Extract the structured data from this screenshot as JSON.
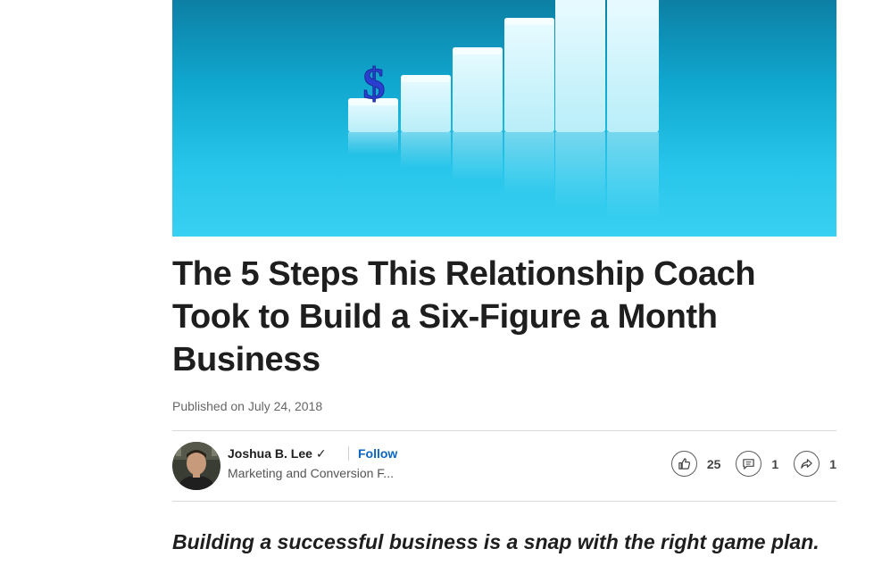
{
  "hero": {
    "icon": "dollar-bar-chart-icon",
    "dollar_symbol": "$"
  },
  "article": {
    "title": "The 5 Steps This Relationship Coach Took to Build a Six-Figure a Month Business",
    "published": "Published on July 24, 2018",
    "intro": "Building a successful business is a snap with the right game plan."
  },
  "author": {
    "name": "Joshua B. Lee",
    "verified_mark": "✓",
    "follow_label": "Follow",
    "headline": "Marketing and Conversion F..."
  },
  "social": {
    "likes": "25",
    "comments": "1",
    "shares": "1"
  },
  "colors": {
    "link": "#0a66c2",
    "hero_bg": "#10a7cf"
  }
}
